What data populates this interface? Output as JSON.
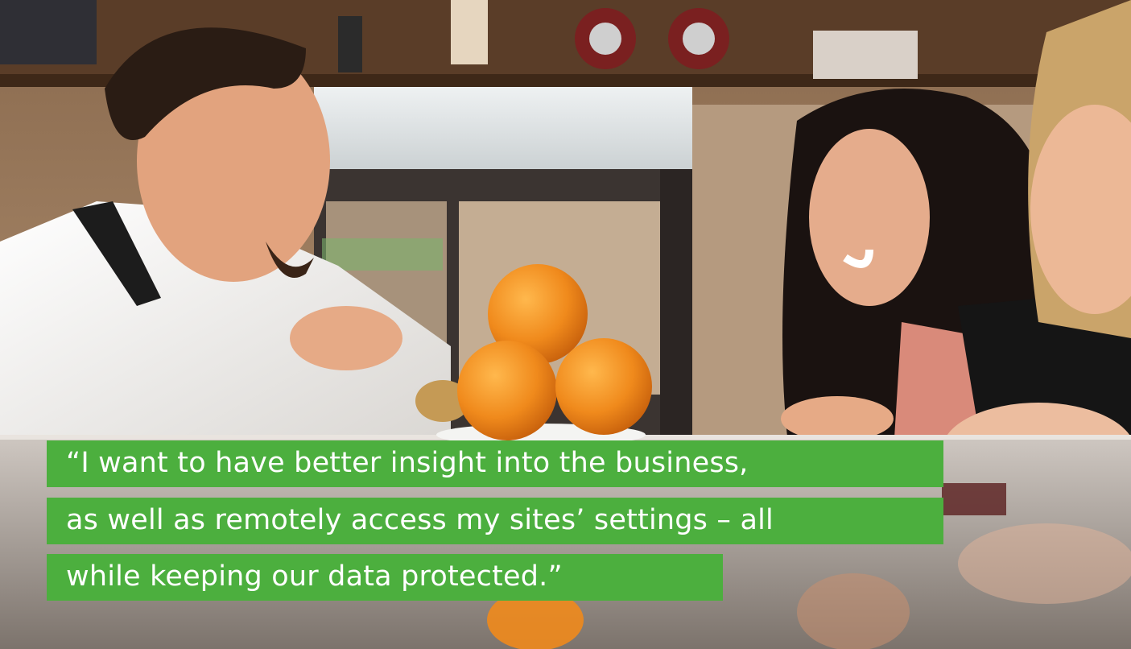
{
  "scene": {
    "description_icon": "cafe-counter-photo",
    "colors": {
      "quote_bg": "#4caf3e",
      "quote_text": "#ffffff",
      "orange": "#f08a1c"
    }
  },
  "quote": {
    "lines": [
      "“I want to have better insight into the business,",
      "as well as remotely access my sites’ settings – all",
      "while keeping our data protected.”"
    ]
  }
}
